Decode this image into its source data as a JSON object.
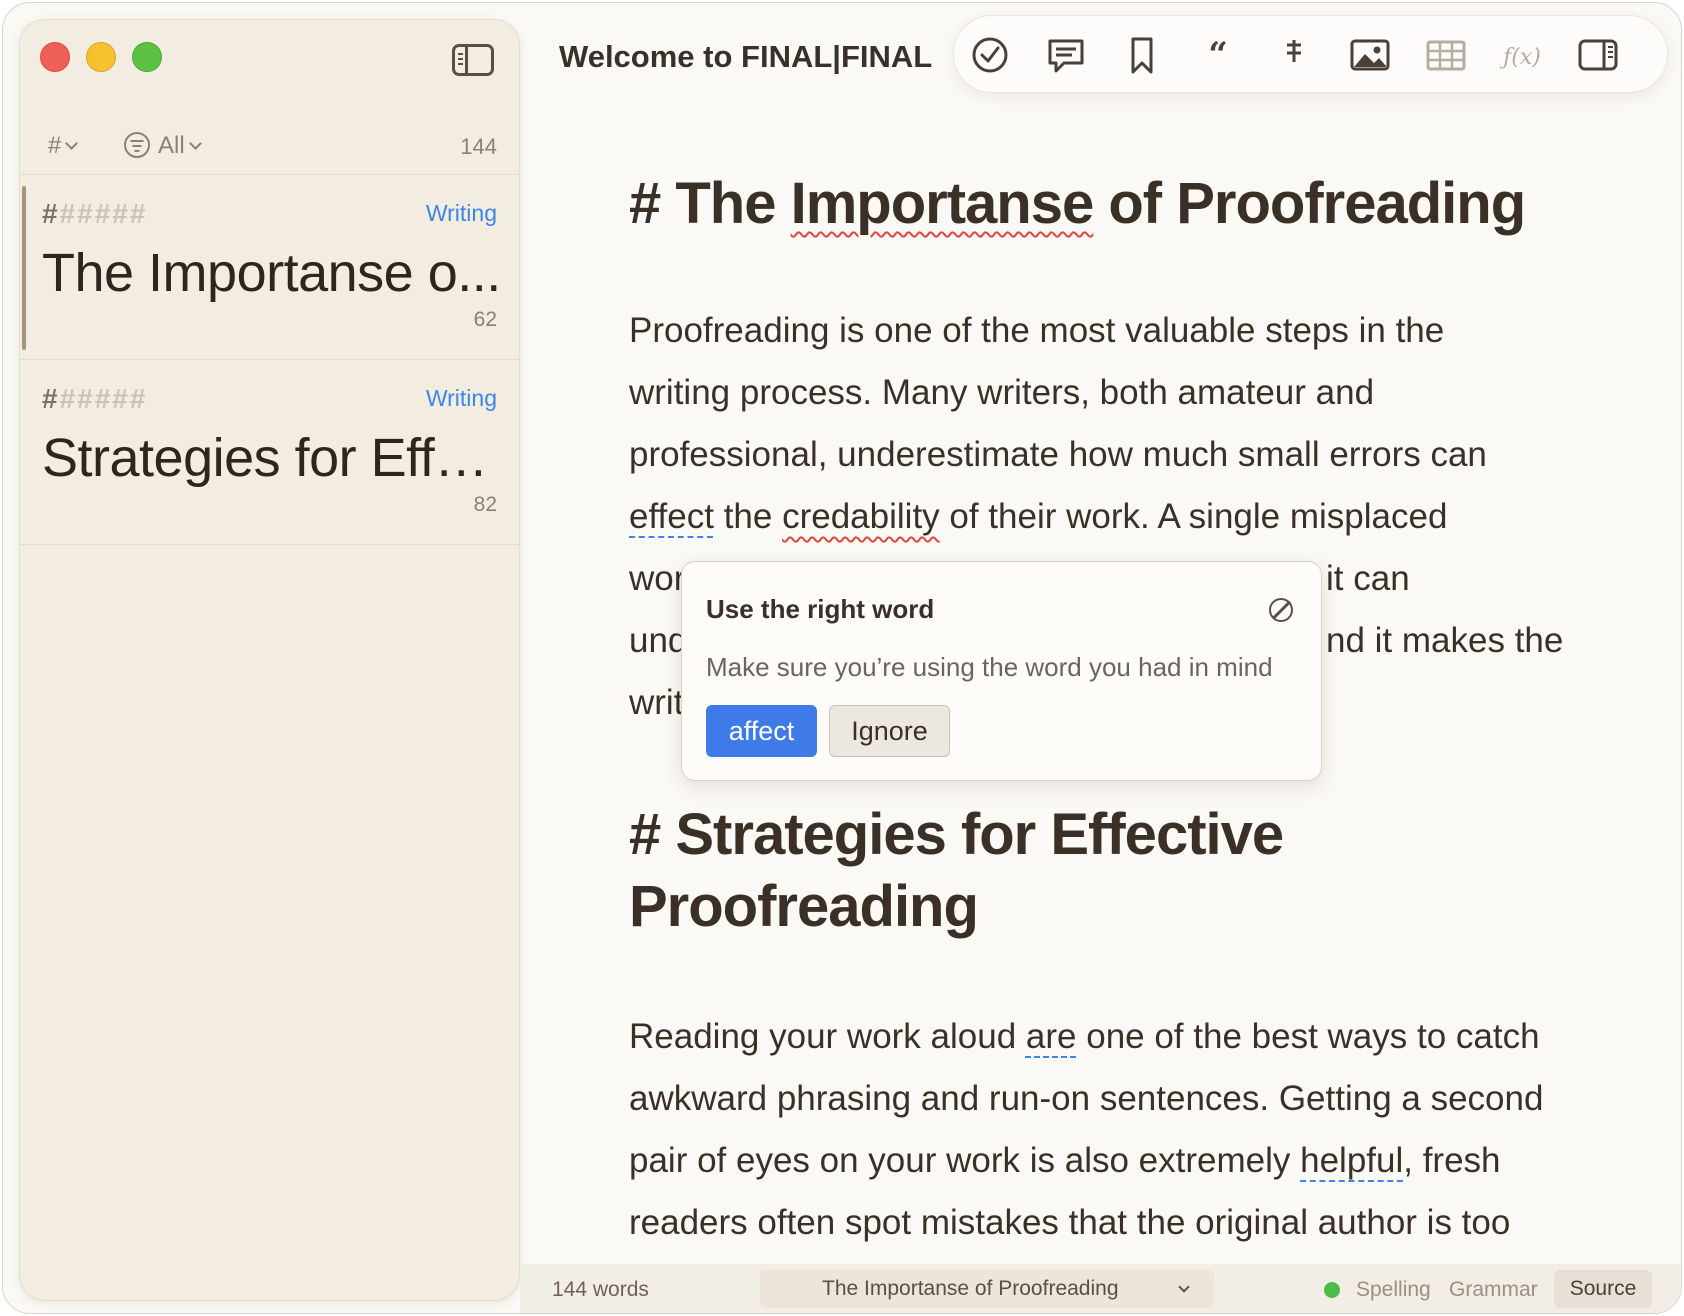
{
  "window": {
    "title": "Welcome to FINAL|FINAL"
  },
  "sidebar": {
    "hash_filter": "#",
    "all_filter": "All",
    "total_count": "144",
    "items": [
      {
        "hashes_first": "#",
        "hashes_rest": "#####",
        "tag": "Writing",
        "title": "The Importanse o...",
        "count": "62"
      },
      {
        "hashes_first": "#",
        "hashes_rest": "#####",
        "tag": "Writing",
        "title": "Strategies for Effe...",
        "count": "82"
      }
    ]
  },
  "toolbar": {
    "icons": [
      "checkmark-icon",
      "comment-icon",
      "bookmark-icon",
      "quote-icon",
      "footnote-icon",
      "image-icon",
      "table-icon",
      "formula-icon",
      "right-sidebar-icon"
    ],
    "formula_label": "ƒ(x)"
  },
  "editor": {
    "h1": {
      "prefix": "# The ",
      "misspelled": "Importanse",
      "rest": " of Proofreading"
    },
    "p1": {
      "line1": "Proofreading is one of the most valuable steps in the",
      "line2": "writing process. Many writers, both amateur and",
      "line3": "professional, underestimate how much small errors can",
      "line4_a": "effect",
      "line4_b": " the ",
      "line4_c": "credability",
      "line4_d": " of their work. A single misplaced",
      "line5_left": "wor",
      "line5_right": "it can",
      "line6_left": "und",
      "line6_right": "nd it makes the",
      "line7_left": "writ"
    },
    "h2": {
      "line1": "# Strategies for Effective",
      "line2": "Proofreading"
    },
    "p2": {
      "line1_a": "Reading your work aloud ",
      "line1_b": "are",
      "line1_c": " one of the best ways to catch",
      "line2": "awkward phrasing and run-on sentences. Getting a second",
      "line3_a": "pair of eyes on your work is also extremely ",
      "line3_b": "helpful",
      "line3_c": ", fresh",
      "line4": "readers often spot mistakes that the original author is too"
    }
  },
  "popover": {
    "title": "Use the right word",
    "description": "Make sure you’re using the word you had in mind",
    "suggestion": "affect",
    "ignore": "Ignore"
  },
  "statusbar": {
    "words": "144 words",
    "current_heading": "The Importanse of Proofreading",
    "spelling": "Spelling",
    "grammar": "Grammar",
    "source": "Source"
  },
  "colors": {
    "accent": "#3f7ae9",
    "sidebar_bg": "#f2ece1",
    "editor_bg": "#fbf9f5",
    "spelling_error": "#e0463f",
    "grammar_hint": "#3b86e8",
    "status_ok": "#4cbc4a"
  }
}
